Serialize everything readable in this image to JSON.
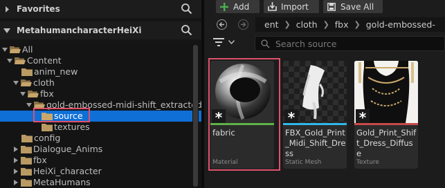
{
  "favorites": {
    "label": "Favorites"
  },
  "project": {
    "label": "MetahumancharacterHeiXi"
  },
  "tree": [
    {
      "label": "All"
    },
    {
      "label": "Content"
    },
    {
      "label": "anim_new"
    },
    {
      "label": "cloth"
    },
    {
      "label": "fbx"
    },
    {
      "label": "gold-embossed-midi-shift_extracted"
    },
    {
      "label": "source",
      "selected": true
    },
    {
      "label": "textures"
    },
    {
      "label": "config"
    },
    {
      "label": "Dialogue_Anims"
    },
    {
      "label": "fbx"
    },
    {
      "label": "HeiXi_character"
    },
    {
      "label": "MetaHumans"
    }
  ],
  "toolbar": {
    "add": "Add",
    "import": "Import",
    "save_all": "Save All"
  },
  "breadcrumbs": [
    "ent",
    "cloth",
    "fbx",
    "gold-embossed-"
  ],
  "search": {
    "placeholder": "Search source"
  },
  "assets": [
    {
      "name": "fabric",
      "type": "Material",
      "bar_color": "#5fb349",
      "highlighted": true
    },
    {
      "name": "FBX_Gold_Print_Midi_Shift_Dress",
      "type": "Static Mesh",
      "bar_color": "#2fb8e8"
    },
    {
      "name": "Gold_Print_Shift_Dress_Diffuse",
      "type": "Texture",
      "bar_color": "#c84a4a"
    }
  ],
  "colors": {
    "selection": "#0f6fd6",
    "highlight_box": "#e0506b",
    "folder": "#b99a63",
    "add_icon": "#4caf50"
  }
}
